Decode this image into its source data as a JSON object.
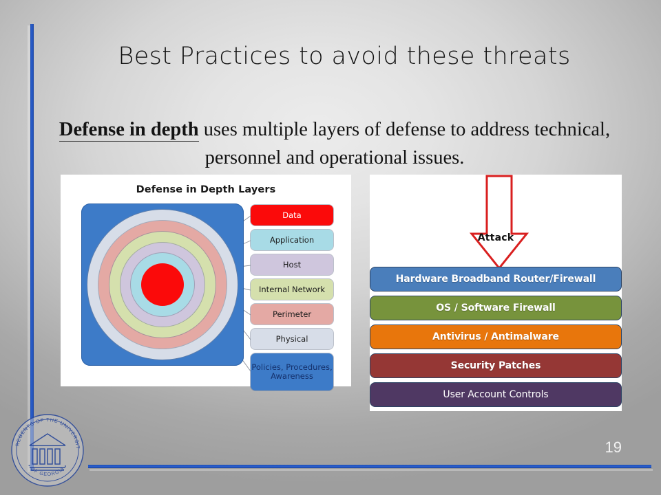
{
  "slide": {
    "title": "Best Practices to avoid these threats",
    "body_strong": "Defense in depth",
    "body_rest": " uses multiple layers of defense to address technical, personnel and operational issues.",
    "page_number": "19"
  },
  "left_panel": {
    "title": "Defense in Depth Layers",
    "labels": [
      {
        "text": "Data",
        "color": "#fb0a0a",
        "text_color": "#ffffff"
      },
      {
        "text": "Application",
        "color": "#a8dbe6",
        "text_color": "#1c1c1c"
      },
      {
        "text": "Host",
        "color": "#cfc6dd",
        "text_color": "#1c1c1c"
      },
      {
        "text": "Internal Network",
        "color": "#d5e0ad",
        "text_color": "#1c1c1c"
      },
      {
        "text": "Perimeter",
        "color": "#e4a9a4",
        "text_color": "#1c1c1c"
      },
      {
        "text": "Physical",
        "color": "#d7dde8",
        "text_color": "#1c1c1c"
      },
      {
        "text": "Policies, Procedures, Awareness",
        "color": "#3d7bc8",
        "text_color": "#14306b"
      }
    ],
    "rings": [
      {
        "name": "policies-procedures-awareness",
        "color": "#3d7bc8"
      },
      {
        "name": "physical",
        "color": "#d7dde8"
      },
      {
        "name": "perimeter",
        "color": "#e4a9a4"
      },
      {
        "name": "internal-network",
        "color": "#d5e0ad"
      },
      {
        "name": "host",
        "color": "#cfc6dd"
      },
      {
        "name": "application",
        "color": "#a8dbe6"
      },
      {
        "name": "data",
        "color": "#fb0a0a"
      }
    ]
  },
  "right_panel": {
    "arrow_label": "Attack",
    "arrow_color": "#d91f1f",
    "bars": [
      {
        "text": "Hardware Broadband Router/Firewall",
        "color": "#4a7ebb",
        "weight": "bold"
      },
      {
        "text": "OS / Software Firewall",
        "color": "#77933c",
        "weight": "bold"
      },
      {
        "text": "Antivirus / Antimalware",
        "color": "#e8760c",
        "weight": "bold"
      },
      {
        "text": "Security Patches",
        "color": "#953735",
        "weight": "bold"
      },
      {
        "text": "User Account Controls",
        "color": "#4f3863",
        "weight": "light"
      }
    ]
  },
  "seal": {
    "outer_text": "BOARD OF REGENTS OF THE UNIVERSITY SYSTEM",
    "inner_text": "OF GEORGIA",
    "color": "#2c4a9a"
  },
  "accents": {
    "rule_blue": "#2a5fcf",
    "background_light": "#ececec",
    "background_dark": "#9e9e9e"
  }
}
